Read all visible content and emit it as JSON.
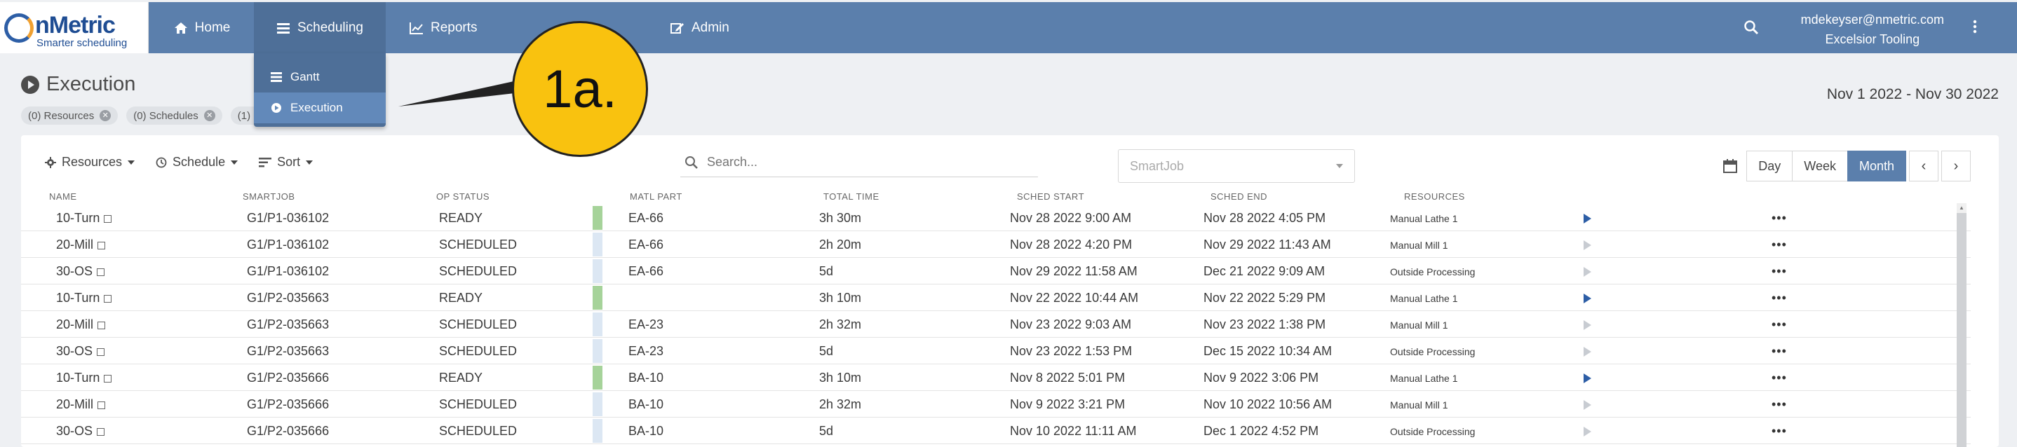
{
  "brand": {
    "name": "nMetric",
    "tagline": "Smarter scheduling"
  },
  "nav": {
    "home": "Home",
    "scheduling": "Scheduling",
    "reports": "Reports",
    "admin": "Admin",
    "scheduling_menu": [
      "Gantt",
      "Execution"
    ]
  },
  "user": {
    "email": "mdekeyser@nmetric.com",
    "org": "Excelsior Tooling"
  },
  "page": {
    "title": "Execution",
    "date_range": "Nov 1 2022 - Nov 30 2022"
  },
  "chips": [
    "(0) Resources",
    "(0) Schedules",
    "(1) So"
  ],
  "callout": "1a.",
  "toolbar": {
    "resources": "Resources",
    "schedule": "Schedule",
    "sort": "Sort",
    "search_placeholder": "Search...",
    "smartjob_placeholder": "SmartJob",
    "views": [
      "Day",
      "Week",
      "Month"
    ],
    "active_view": "Month"
  },
  "columns": [
    "NAME",
    "SMARTJOB",
    "OP STATUS",
    "MATL PART",
    "TOTAL TIME",
    "SCHED START",
    "SCHED END",
    "RESOURCES"
  ],
  "status_colors": {
    "READY": "#a6d39a",
    "SCHEDULED": "#dce7f3"
  },
  "rows": [
    {
      "name": "10-Turn",
      "smartjob": "G1/P1-036102",
      "status": "READY",
      "part": "EA-66",
      "total": "3h 30m",
      "start": "Nov 28 2022 9:00 AM",
      "end": "Nov 28 2022 4:05 PM",
      "resource": "Manual Lathe 1"
    },
    {
      "name": "20-Mill",
      "smartjob": "G1/P1-036102",
      "status": "SCHEDULED",
      "part": "EA-66",
      "total": "2h 20m",
      "start": "Nov 28 2022 4:20 PM",
      "end": "Nov 29 2022 11:43 AM",
      "resource": "Manual Mill 1"
    },
    {
      "name": "30-OS",
      "smartjob": "G1/P1-036102",
      "status": "SCHEDULED",
      "part": "EA-66",
      "total": "5d",
      "start": "Nov 29 2022 11:58 AM",
      "end": "Dec 21 2022 9:09 AM",
      "resource": "Outside Processing"
    },
    {
      "name": "10-Turn",
      "smartjob": "G1/P2-035663",
      "status": "READY",
      "part": "",
      "total": "3h 10m",
      "start": "Nov 22 2022 10:44 AM",
      "end": "Nov 22 2022 5:29 PM",
      "resource": "Manual Lathe 1"
    },
    {
      "name": "20-Mill",
      "smartjob": "G1/P2-035663",
      "status": "SCHEDULED",
      "part": "EA-23",
      "total": "2h 32m",
      "start": "Nov 23 2022 9:03 AM",
      "end": "Nov 23 2022 1:38 PM",
      "resource": "Manual Mill 1"
    },
    {
      "name": "30-OS",
      "smartjob": "G1/P2-035663",
      "status": "SCHEDULED",
      "part": "EA-23",
      "total": "5d",
      "start": "Nov 23 2022 1:53 PM",
      "end": "Dec 15 2022 10:34 AM",
      "resource": "Outside Processing"
    },
    {
      "name": "10-Turn",
      "smartjob": "G1/P2-035666",
      "status": "READY",
      "part": "BA-10",
      "total": "3h 10m",
      "start": "Nov 8 2022 5:01 PM",
      "end": "Nov 9 2022 3:06 PM",
      "resource": "Manual Lathe 1"
    },
    {
      "name": "20-Mill",
      "smartjob": "G1/P2-035666",
      "status": "SCHEDULED",
      "part": "BA-10",
      "total": "2h 32m",
      "start": "Nov 9 2022 3:21 PM",
      "end": "Nov 10 2022 10:56 AM",
      "resource": "Manual Mill 1"
    },
    {
      "name": "30-OS",
      "smartjob": "G1/P2-035666",
      "status": "SCHEDULED",
      "part": "BA-10",
      "total": "5d",
      "start": "Nov 10 2022 11:11 AM",
      "end": "Dec 1 2022 4:52 PM",
      "resource": "Outside Processing"
    }
  ]
}
